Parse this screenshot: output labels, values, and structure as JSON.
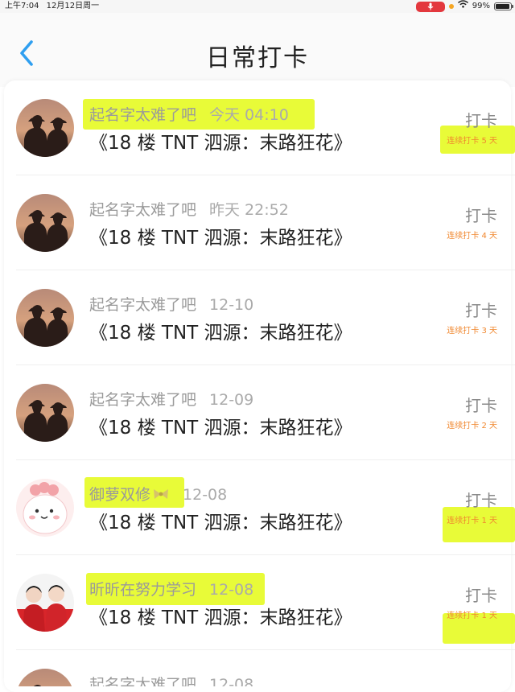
{
  "status": {
    "time": "上午7:04",
    "date": "12月12日周一",
    "battery": "99%"
  },
  "header": {
    "title": "日常打卡",
    "back_icon": "chevron-left-icon"
  },
  "colors": {
    "accent": "#2f9ff0",
    "streak": "#f0872e",
    "highlight": "#e2fa00"
  },
  "entries": [
    {
      "name": "起名字太难了吧",
      "time": "今天 04:10",
      "message": "《18 楼 TNT 泗源：末路狂花》",
      "action": "打卡",
      "streak": "连续打卡 5 天",
      "avatar": "silhouette-couple"
    },
    {
      "name": "起名字太难了吧",
      "time": "昨天 22:52",
      "message": "《18 楼 TNT 泗源：末路狂花》",
      "action": "打卡",
      "streak": "连续打卡 4 天",
      "avatar": "silhouette-couple"
    },
    {
      "name": "起名字太难了吧",
      "time": "12-10",
      "message": "《18 楼 TNT 泗源：末路狂花》",
      "action": "打卡",
      "streak": "连续打卡 3 天",
      "avatar": "silhouette-couple"
    },
    {
      "name": "起名字太难了吧",
      "time": "12-09",
      "message": "《18 楼 TNT 泗源：末路狂花》",
      "action": "打卡",
      "streak": "连续打卡 2 天",
      "avatar": "silhouette-couple"
    },
    {
      "name": "御萝双修",
      "time": "12-08",
      "message": "《18 楼 TNT 泗源：末路狂花》",
      "action": "打卡",
      "streak": "连续打卡 1 天",
      "avatar": "pink-cartoon"
    },
    {
      "name": "昕昕在努力学习",
      "time": "12-08",
      "message": "《18 楼 TNT 泗源：末路狂花》",
      "action": "打卡",
      "streak": "连续打卡 1 天",
      "avatar": "red-outfit-duo"
    },
    {
      "name": "起名字太难了吧",
      "time": "12-08",
      "avatar": "silhouette-couple"
    }
  ]
}
